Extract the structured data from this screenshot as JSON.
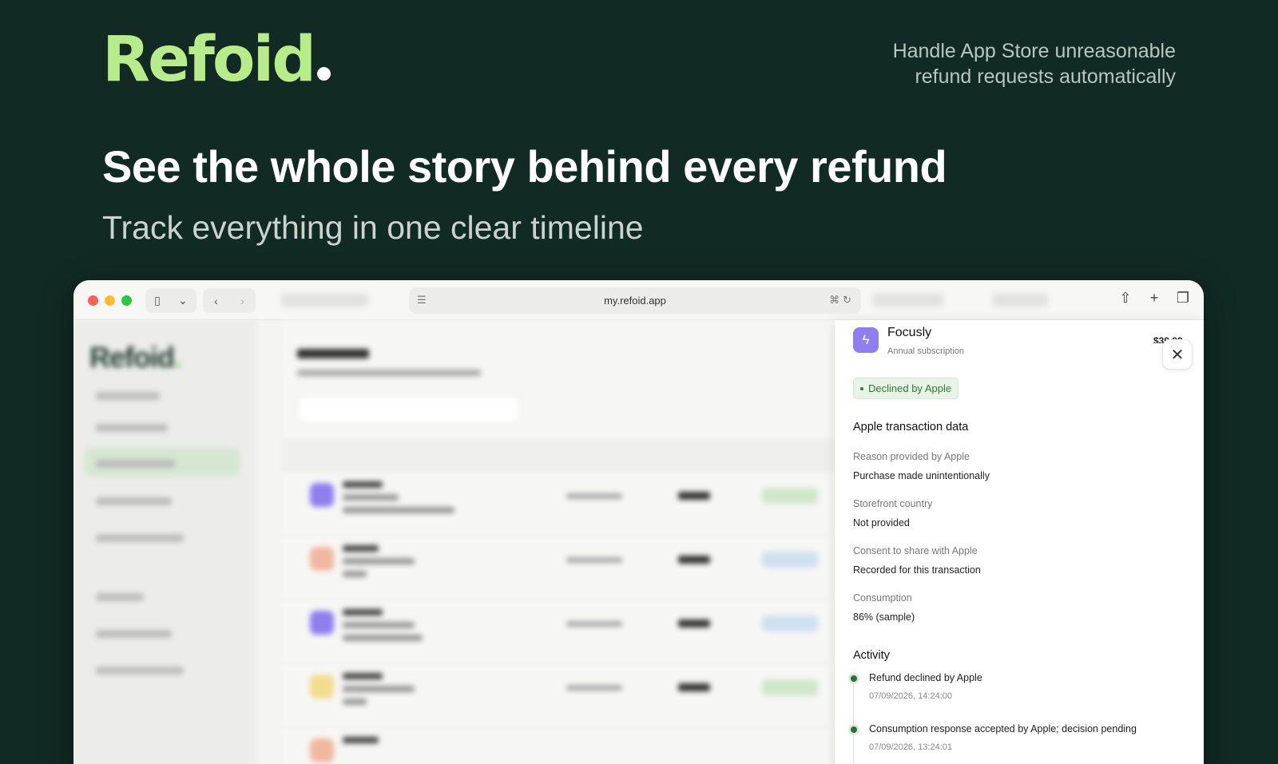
{
  "hero": {
    "logo": "Refoid",
    "tagline": "Handle App Store unreasonable refund requests automatically",
    "headline": "See the whole story behind every refund",
    "subheadline": "Track everything in one clear timeline"
  },
  "browser": {
    "url": "my.refoid.app"
  },
  "detail": {
    "app_name": "Focusly",
    "plan": "Annual subscription",
    "price": "$39.99",
    "status": "Declined by Apple",
    "section_transaction": "Apple transaction data",
    "fields": [
      {
        "label": "Reason provided by Apple",
        "value": "Purchase made unintentionally"
      },
      {
        "label": "Storefront country",
        "value": "Not provided"
      },
      {
        "label": "Consent to share with Apple",
        "value": "Recorded for this transaction"
      },
      {
        "label": "Consumption",
        "value": "86% (sample)"
      }
    ],
    "section_activity": "Activity",
    "activity": [
      {
        "title": "Refund declined by Apple",
        "time": "07/09/2026, 14:24:00"
      },
      {
        "title": "Consumption response accepted by Apple; decision pending",
        "time": "07/09/2026, 13:24:01"
      }
    ]
  },
  "colors": {
    "background": "#112a23",
    "brand_green": "#b8ec8a",
    "status_green": "#2e7a3b",
    "app_icon": "#8f7ef0"
  }
}
